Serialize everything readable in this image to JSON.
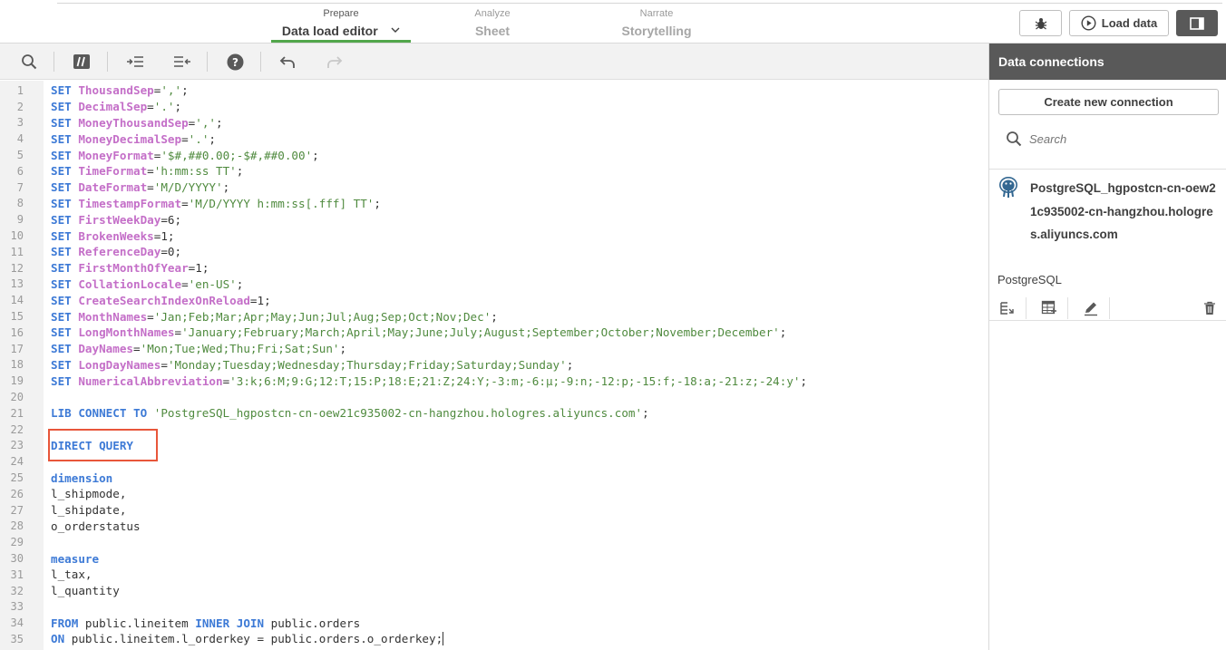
{
  "tabs": [
    {
      "sub": "Prepare",
      "main": "Data load editor"
    },
    {
      "sub": "Analyze",
      "main": "Sheet"
    },
    {
      "sub": "Narrate",
      "main": "Storytelling"
    }
  ],
  "toolbar": {
    "load_data_label": "Load data"
  },
  "icons": {
    "search": "search-icon",
    "comment": "comment-icon",
    "indent": "indent-icon",
    "outdent": "outdent-icon",
    "help": "help-icon",
    "undo": "undo-icon",
    "redo": "redo-icon",
    "debug": "bug-icon",
    "load": "play-icon",
    "panel": "panel-toggle-icon"
  },
  "colors": {
    "keyword": "#3d7ad6",
    "variable": "#c46fc8",
    "string": "#4f8a3e",
    "accent": "#52a64b",
    "highlight": "#e8563a"
  },
  "code": [
    [
      {
        "t": "SET ",
        "c": "kw"
      },
      {
        "t": "ThousandSep",
        "c": "var"
      },
      {
        "t": "=",
        "c": "plain"
      },
      {
        "t": "','",
        "c": "str"
      },
      {
        "t": ";",
        "c": "plain"
      }
    ],
    [
      {
        "t": "SET ",
        "c": "kw"
      },
      {
        "t": "DecimalSep",
        "c": "var"
      },
      {
        "t": "=",
        "c": "plain"
      },
      {
        "t": "'.'",
        "c": "str"
      },
      {
        "t": ";",
        "c": "plain"
      }
    ],
    [
      {
        "t": "SET ",
        "c": "kw"
      },
      {
        "t": "MoneyThousandSep",
        "c": "var"
      },
      {
        "t": "=",
        "c": "plain"
      },
      {
        "t": "','",
        "c": "str"
      },
      {
        "t": ";",
        "c": "plain"
      }
    ],
    [
      {
        "t": "SET ",
        "c": "kw"
      },
      {
        "t": "MoneyDecimalSep",
        "c": "var"
      },
      {
        "t": "=",
        "c": "plain"
      },
      {
        "t": "'.'",
        "c": "str"
      },
      {
        "t": ";",
        "c": "plain"
      }
    ],
    [
      {
        "t": "SET ",
        "c": "kw"
      },
      {
        "t": "MoneyFormat",
        "c": "var"
      },
      {
        "t": "=",
        "c": "plain"
      },
      {
        "t": "'$#,##0.00;-$#,##0.00'",
        "c": "str"
      },
      {
        "t": ";",
        "c": "plain"
      }
    ],
    [
      {
        "t": "SET ",
        "c": "kw"
      },
      {
        "t": "TimeFormat",
        "c": "var"
      },
      {
        "t": "=",
        "c": "plain"
      },
      {
        "t": "'h:mm:ss TT'",
        "c": "str"
      },
      {
        "t": ";",
        "c": "plain"
      }
    ],
    [
      {
        "t": "SET ",
        "c": "kw"
      },
      {
        "t": "DateFormat",
        "c": "var"
      },
      {
        "t": "=",
        "c": "plain"
      },
      {
        "t": "'M/D/YYYY'",
        "c": "str"
      },
      {
        "t": ";",
        "c": "plain"
      }
    ],
    [
      {
        "t": "SET ",
        "c": "kw"
      },
      {
        "t": "TimestampFormat",
        "c": "var"
      },
      {
        "t": "=",
        "c": "plain"
      },
      {
        "t": "'M/D/YYYY h:mm:ss[.fff] TT'",
        "c": "str"
      },
      {
        "t": ";",
        "c": "plain"
      }
    ],
    [
      {
        "t": "SET ",
        "c": "kw"
      },
      {
        "t": "FirstWeekDay",
        "c": "var"
      },
      {
        "t": "=6;",
        "c": "plain"
      }
    ],
    [
      {
        "t": "SET ",
        "c": "kw"
      },
      {
        "t": "BrokenWeeks",
        "c": "var"
      },
      {
        "t": "=1;",
        "c": "plain"
      }
    ],
    [
      {
        "t": "SET ",
        "c": "kw"
      },
      {
        "t": "ReferenceDay",
        "c": "var"
      },
      {
        "t": "=0;",
        "c": "plain"
      }
    ],
    [
      {
        "t": "SET ",
        "c": "kw"
      },
      {
        "t": "FirstMonthOfYear",
        "c": "var"
      },
      {
        "t": "=1;",
        "c": "plain"
      }
    ],
    [
      {
        "t": "SET ",
        "c": "kw"
      },
      {
        "t": "CollationLocale",
        "c": "var"
      },
      {
        "t": "=",
        "c": "plain"
      },
      {
        "t": "'en-US'",
        "c": "str"
      },
      {
        "t": ";",
        "c": "plain"
      }
    ],
    [
      {
        "t": "SET ",
        "c": "kw"
      },
      {
        "t": "CreateSearchIndexOnReload",
        "c": "var"
      },
      {
        "t": "=1;",
        "c": "plain"
      }
    ],
    [
      {
        "t": "SET ",
        "c": "kw"
      },
      {
        "t": "MonthNames",
        "c": "var"
      },
      {
        "t": "=",
        "c": "plain"
      },
      {
        "t": "'Jan;Feb;Mar;Apr;May;Jun;Jul;Aug;Sep;Oct;Nov;Dec'",
        "c": "str"
      },
      {
        "t": ";",
        "c": "plain"
      }
    ],
    [
      {
        "t": "SET ",
        "c": "kw"
      },
      {
        "t": "LongMonthNames",
        "c": "var"
      },
      {
        "t": "=",
        "c": "plain"
      },
      {
        "t": "'January;February;March;April;May;June;July;August;September;October;November;December'",
        "c": "str"
      },
      {
        "t": ";",
        "c": "plain"
      }
    ],
    [
      {
        "t": "SET ",
        "c": "kw"
      },
      {
        "t": "DayNames",
        "c": "var"
      },
      {
        "t": "=",
        "c": "plain"
      },
      {
        "t": "'Mon;Tue;Wed;Thu;Fri;Sat;Sun'",
        "c": "str"
      },
      {
        "t": ";",
        "c": "plain"
      }
    ],
    [
      {
        "t": "SET ",
        "c": "kw"
      },
      {
        "t": "LongDayNames",
        "c": "var"
      },
      {
        "t": "=",
        "c": "plain"
      },
      {
        "t": "'Monday;Tuesday;Wednesday;Thursday;Friday;Saturday;Sunday'",
        "c": "str"
      },
      {
        "t": ";",
        "c": "plain"
      }
    ],
    [
      {
        "t": "SET ",
        "c": "kw"
      },
      {
        "t": "NumericalAbbreviation",
        "c": "var"
      },
      {
        "t": "=",
        "c": "plain"
      },
      {
        "t": "'3:k;6:M;9:G;12:T;15:P;18:E;21:Z;24:Y;-3:m;-6:μ;-9:n;-12:p;-15:f;-18:a;-21:z;-24:y'",
        "c": "str"
      },
      {
        "t": ";",
        "c": "plain"
      }
    ],
    [],
    [
      {
        "t": "LIB CONNECT TO ",
        "c": "kw"
      },
      {
        "t": "'PostgreSQL_hgpostcn-cn-oew21c935002-cn-hangzhou.hologres.aliyuncs.com'",
        "c": "str"
      },
      {
        "t": ";",
        "c": "plain"
      }
    ],
    [],
    [
      {
        "t": "DIRECT QUERY",
        "c": "kw"
      }
    ],
    [],
    [
      {
        "t": "dimension",
        "c": "kw"
      }
    ],
    [
      {
        "t": "l_shipmode,",
        "c": "plain"
      }
    ],
    [
      {
        "t": "l_shipdate,",
        "c": "plain"
      }
    ],
    [
      {
        "t": "o_orderstatus",
        "c": "plain"
      }
    ],
    [],
    [
      {
        "t": "measure",
        "c": "kw"
      }
    ],
    [
      {
        "t": "l_tax,",
        "c": "plain"
      }
    ],
    [
      {
        "t": "l_quantity",
        "c": "plain"
      }
    ],
    [],
    [
      {
        "t": "FROM ",
        "c": "kw"
      },
      {
        "t": "public.lineitem ",
        "c": "plain"
      },
      {
        "t": "INNER JOIN ",
        "c": "kw"
      },
      {
        "t": "public.orders",
        "c": "plain"
      }
    ],
    [
      {
        "t": "ON ",
        "c": "kw"
      },
      {
        "t": "public.lineitem.l_orderkey = public.orders.o_orderkey;",
        "c": "plain"
      }
    ]
  ],
  "panel": {
    "title": "Data connections",
    "create_label": "Create new connection",
    "search_placeholder": "Search",
    "connection": {
      "name": "PostgreSQL_hgpostcn-cn-oew21c935002-cn-hangzhou.hologres.aliyuncs.com",
      "type": "PostgreSQL"
    }
  }
}
